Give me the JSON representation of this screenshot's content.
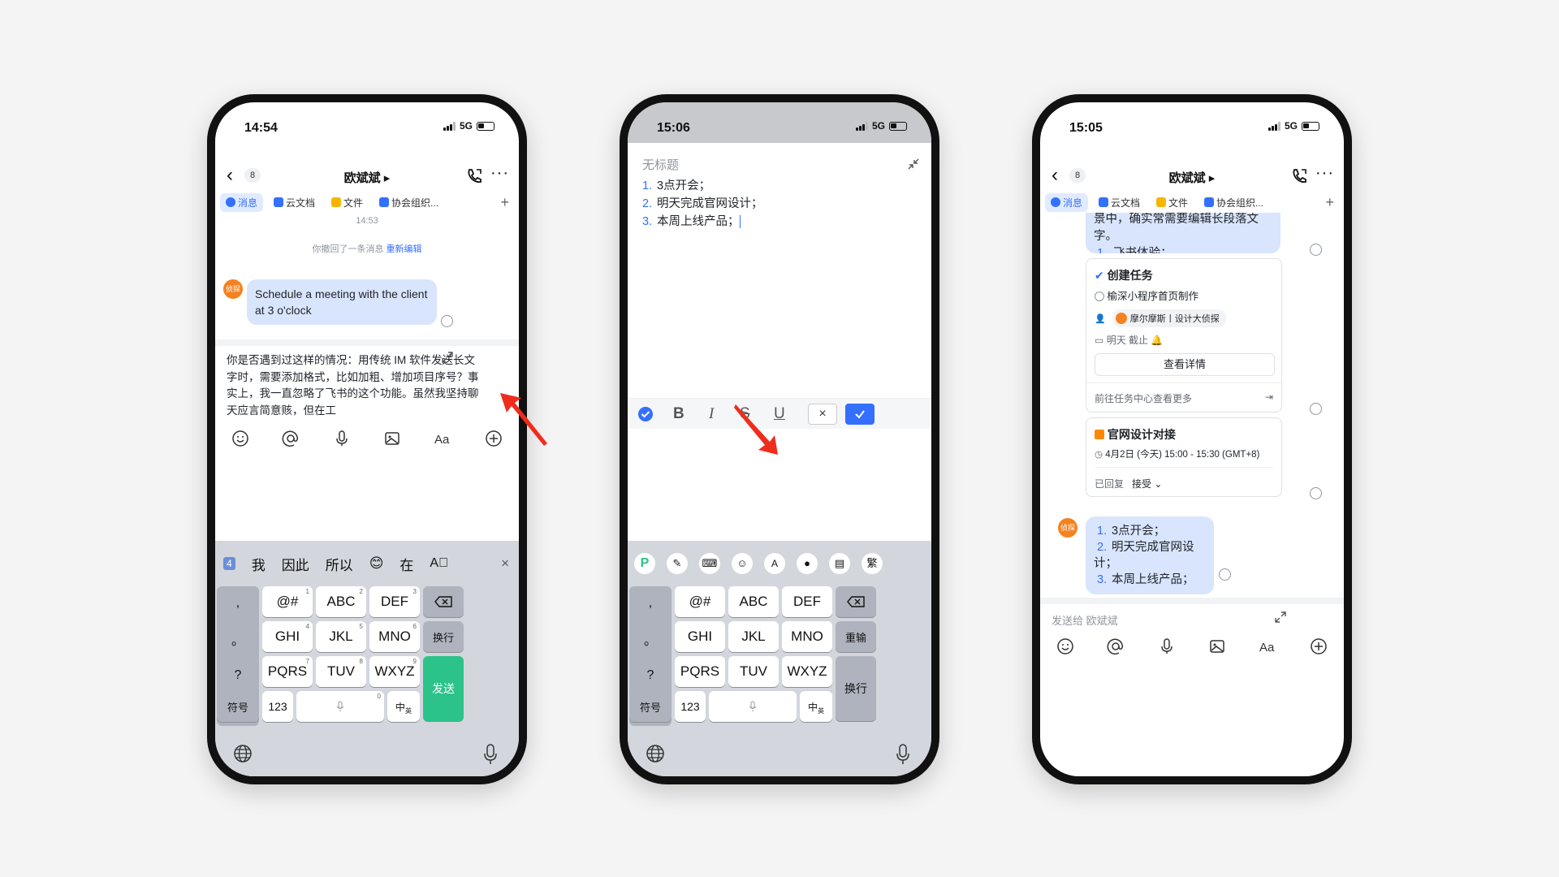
{
  "phone1": {
    "time": "14:54",
    "network": "5G",
    "nav": {
      "badge": "8",
      "title": "欧斌斌 ▸"
    },
    "tabs": [
      {
        "label": "消息",
        "color": "#3370ff"
      },
      {
        "label": "云文档",
        "color": "#3370ff"
      },
      {
        "label": "文件",
        "color": "#f7b500"
      },
      {
        "label": "协会组织...",
        "color": "#3370ff"
      }
    ],
    "timestamp": "14:53",
    "recall_text": "你撤回了一条消息",
    "reedit": "重新编辑",
    "avatar_label": "侦探",
    "message": "Schedule a meeting with the client at 3 o'clock",
    "draft": "你是否遇到过这样的情况：用传统 IM 软件发送长文字时，需要添加格式，比如加粗、增加项目序号？事实上，我一直忽略了飞书的这个功能。虽然我坚持聊天应言简意赅，但在工",
    "candidates": [
      "4️",
      "我",
      "因此",
      "所以",
      "😊",
      "在"
    ],
    "keys": {
      "row1": [
        "@#",
        "ABC",
        "DEF"
      ],
      "row2": [
        "GHI",
        "JKL",
        "MNO"
      ],
      "row3": [
        "PQRS",
        "TUV",
        "WXYZ"
      ],
      "nums": [
        "1",
        "2",
        "3",
        "4",
        "5",
        "6",
        "7",
        "8",
        "9",
        "0"
      ],
      "punct": [
        ",",
        "。",
        "?",
        "!"
      ],
      "symbol": "符号",
      "num123": "123",
      "newline": "换行",
      "send": "发送",
      "lang": "中",
      "lang_sub": "英"
    }
  },
  "phone2": {
    "time": "15:06",
    "network": "5G",
    "doc_title": "无标题",
    "items": [
      "3点开会；",
      "明天完成官网设计；",
      "本周上线产品；"
    ],
    "nums": [
      "1.",
      "2.",
      "3."
    ],
    "keys": {
      "row1": [
        "@#",
        "ABC",
        "DEF"
      ],
      "row2": [
        "GHI",
        "JKL",
        "MNO"
      ],
      "row3": [
        "PQRS",
        "TUV",
        "WXYZ"
      ],
      "punct": [
        ",",
        "。",
        "?",
        "!"
      ],
      "symbol": "符号",
      "num123": "123",
      "reenter": "重输",
      "newline": "换行",
      "lang": "中",
      "lang_sub": "英",
      "trad": "繁"
    }
  },
  "phone3": {
    "time": "15:05",
    "network": "5G",
    "nav": {
      "badge": "8",
      "title": "欧斌斌 ▸"
    },
    "tabs": [
      {
        "label": "消息"
      },
      {
        "label": "云文档"
      },
      {
        "label": "文件"
      },
      {
        "label": "协会组织..."
      }
    ],
    "partial_text": "景中，确实常需要编辑长段落文字。",
    "partial_item": "飞书体验；",
    "partial_num": "1.",
    "task": {
      "title": "创建任务",
      "name": "榆深小程序首页制作",
      "assignee": "摩尔摩斯丨设计大侦探",
      "due": "明天 截止",
      "detail_btn": "查看详情",
      "more": "前往任务中心查看更多"
    },
    "event": {
      "title": "官网设计对接",
      "time": "4月2日 (今天) 15:00 - 15:30 (GMT+8)",
      "replied": "已回复",
      "accept": "接受 ⌄"
    },
    "avatar_label": "侦探",
    "list": [
      "3点开会；",
      "明天完成官网设计；",
      "本周上线产品；"
    ],
    "list_nums": [
      "1.",
      "2.",
      "3."
    ],
    "input_placeholder": "发送给 欧斌斌"
  }
}
